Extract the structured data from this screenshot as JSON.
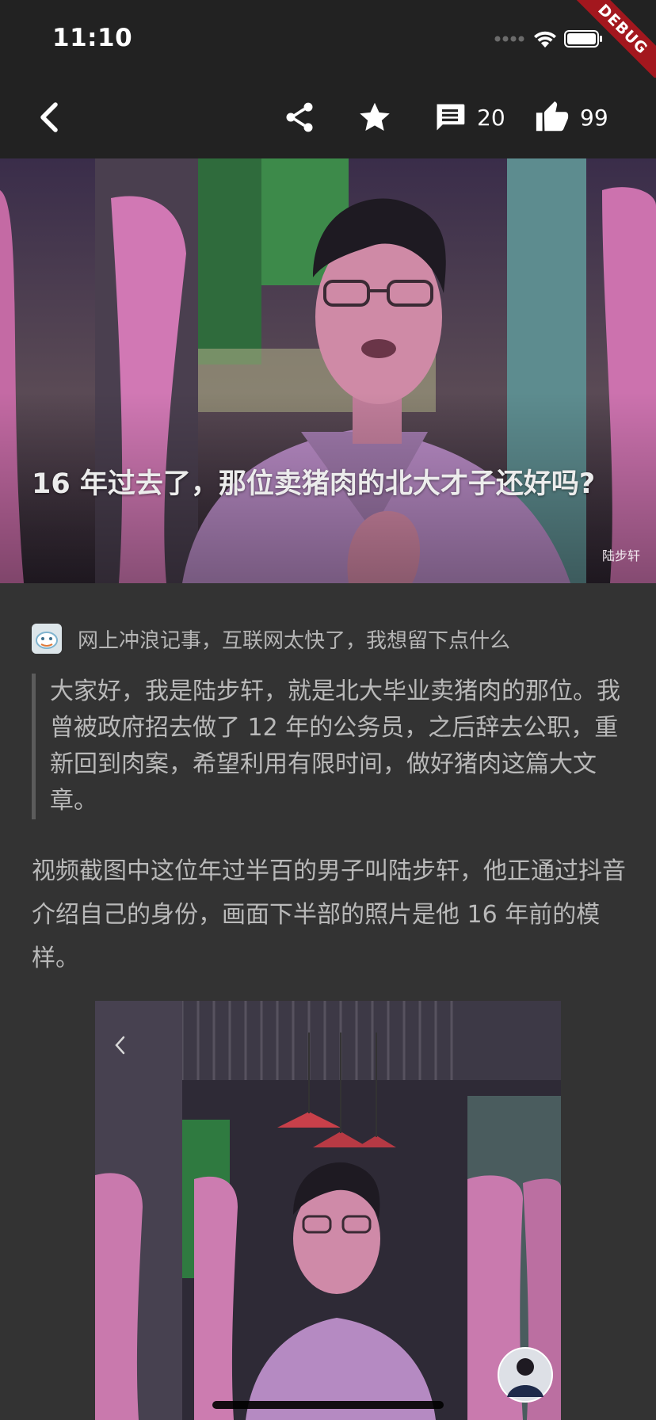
{
  "status_bar": {
    "time": "11:10",
    "debug_label": "DEBUG"
  },
  "nav": {
    "comment_count": "20",
    "like_count": "99",
    "icons": [
      "back-icon",
      "share-icon",
      "star-icon",
      "comment-icon",
      "thumbs-up-icon"
    ]
  },
  "article": {
    "title": "16 年过去了，那位卖猪肉的北大才子还好吗?",
    "image_credit": "陆步轩",
    "source": "网上冲浪记事，互联网太快了，我想留下点什么",
    "quote": "大家好，我是陆步轩，就是北大毕业卖猪肉的那位。我曾被政府招去做了 12 年的公务员，之后辞去公职，重新回到肉案，希望利用有限时间，做好猪肉这篇大文章。",
    "paragraph": "视频截图中这位年过半百的男子叫陆步轩，他正通过抖音介绍自己的身份，画面下半部的照片是他 16 年前的模样。"
  },
  "colors": {
    "background": "#333333",
    "bar": "#222222",
    "text": "#b9b9b9",
    "debug": "#a3171e"
  }
}
